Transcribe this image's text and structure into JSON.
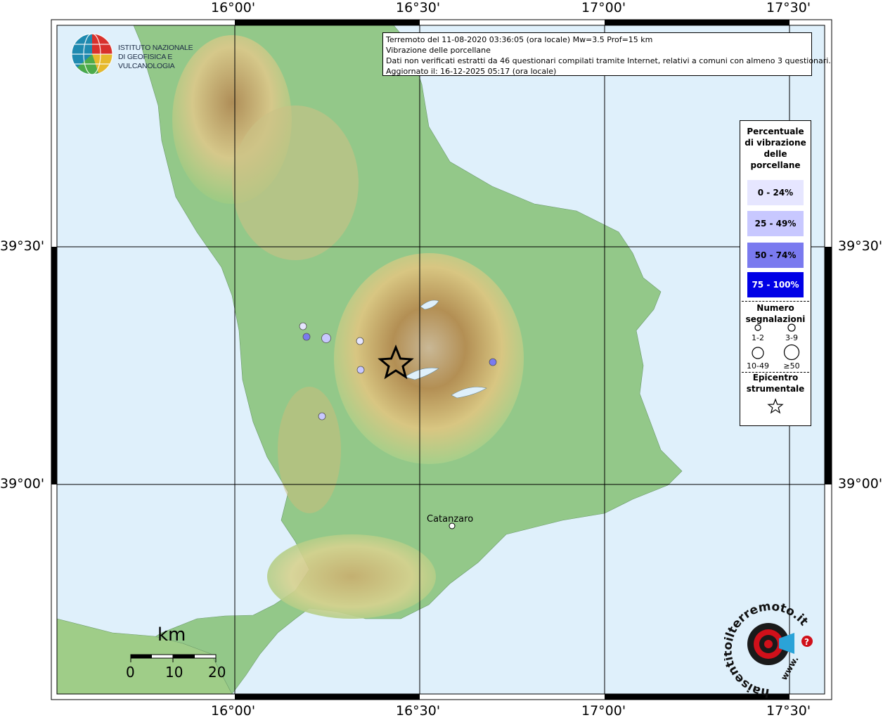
{
  "header": {
    "line1": "Terremoto del 11-08-2020 03:36:05 (ora locale) Mw=3.5 Prof=15 km",
    "line2": "Vibrazione delle porcellane",
    "line3": "Dati non verificati estratti da 46 questionari compilati tramite Internet, relativi a comuni con almeno 3 questionari.",
    "line4": "Aggiornato il: 16-12-2025 05:17 (ora locale)"
  },
  "logo_ingv": {
    "line1": "ISTITUTO NAZIONALE",
    "line2": "DI GEOFISICA E VULCANOLOGIA"
  },
  "axes": {
    "lon_labels": [
      "16°00'",
      "16°30'",
      "17°00'",
      "17°30'"
    ],
    "lat_labels": [
      "39°30'",
      "39°00'"
    ]
  },
  "legend": {
    "title": [
      "Percentuale",
      "di vibrazione",
      "delle",
      "porcellane"
    ],
    "classes": [
      {
        "label": "0 - 24%",
        "color": "#e6e6ff"
      },
      {
        "label": "25 - 49%",
        "color": "#c8c8ff"
      },
      {
        "label": "50 - 74%",
        "color": "#7a7aef"
      },
      {
        "label": "75 - 100%",
        "color": "#0000e6"
      }
    ],
    "count_title": [
      "Numero",
      "segnalazioni"
    ],
    "sizes": [
      "1-2",
      "3-9",
      "10-49",
      "≥50"
    ],
    "epicenter_title": [
      "Epicentro",
      "strumentale"
    ]
  },
  "places": {
    "catanzaro": "Catanzaro"
  },
  "scale": {
    "unit": "km",
    "labels": [
      "0",
      "10",
      "20"
    ]
  },
  "hst_logo": {
    "text": "haisentitoilterremoto.it",
    "www": "www."
  },
  "colors": {
    "sea": "#dff0fb",
    "land_low": "#8cc685",
    "land_mid": "#e8dc9c",
    "land_high": "#a8844a",
    "accent_red": "#d0101a"
  },
  "observations": [
    {
      "class": 0,
      "size": "1-2"
    },
    {
      "class": 2,
      "size": "1-2"
    },
    {
      "class": 1,
      "size": "3-9"
    },
    {
      "class": 0,
      "size": "1-2"
    },
    {
      "class": 1,
      "size": "1-2"
    },
    {
      "class": 1,
      "size": "1-2"
    },
    {
      "class": 2,
      "size": "1-2"
    }
  ]
}
